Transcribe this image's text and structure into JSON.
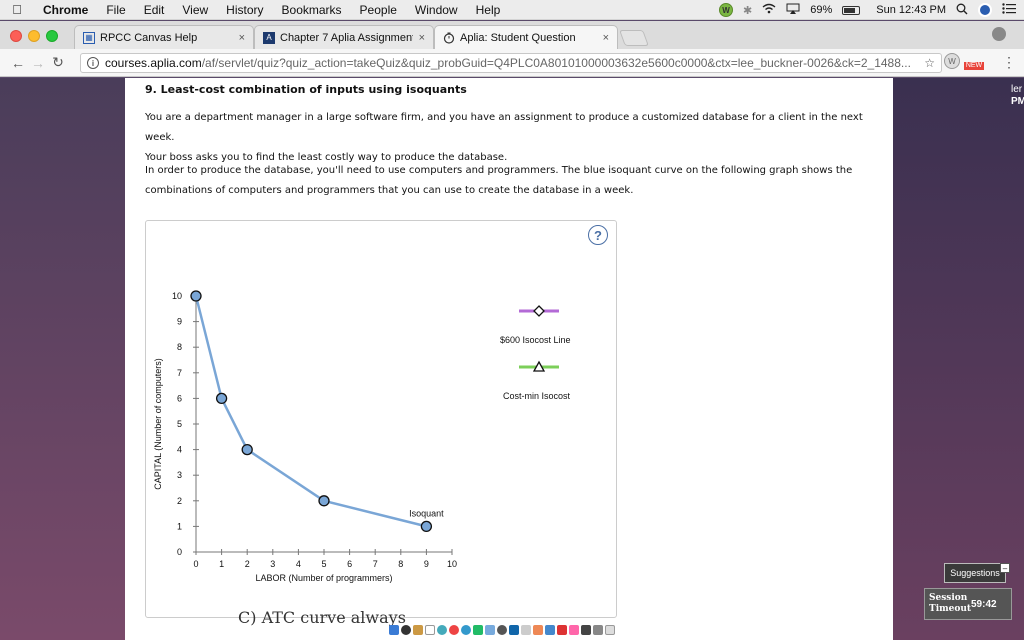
{
  "menubar": {
    "app": "Chrome",
    "items": [
      "File",
      "Edit",
      "View",
      "History",
      "Bookmarks",
      "People",
      "Window",
      "Help"
    ],
    "battery": "69%",
    "clock": "Sun 12:43 PM",
    "ext_letter": "W"
  },
  "tabs": [
    {
      "label": "RPCC Canvas Help",
      "close": "×"
    },
    {
      "label": "Chapter 7 Aplia Assignment",
      "close": "×"
    },
    {
      "label": "Aplia: Student Question",
      "close": "×"
    }
  ],
  "toolbar": {
    "url_host": "courses.aplia.com",
    "url_path": "/af/servlet/quiz?quiz_action=takeQuiz&quiz_probGuid=Q4PLC0A80101000003632e5600c0000&ctx=lee_buckner-0026&ck=2_1488...",
    "ext_new": "NEW",
    "ext_w": "W"
  },
  "question": {
    "title": "9. Least-cost combination of inputs using isoquants",
    "para1_line1": "You are a department manager in a large software firm, and you have an assignment to produce a customized database for a client in the next week.",
    "para1_line2": "Your boss asks you to find the least costly way to produce the database.",
    "para2_line1": "In order to produce the database, you'll need to use computers and programmers. The blue isoquant curve on the following graph shows the",
    "para2_line2": "combinations of computers and programmers that you can use to create the database in a week."
  },
  "graph": {
    "help": "?",
    "legend": [
      {
        "label": "$600 Isocost Line",
        "color": "#b36ad6",
        "marker": "diamond"
      },
      {
        "label": "Cost-min Isocost",
        "color": "#7ccf5a",
        "marker": "triangle"
      }
    ]
  },
  "chart_data": {
    "type": "line",
    "xlabel": "LABOR (Number of programmers)",
    "ylabel": "CAPITAL (Number of computers)",
    "xlim": [
      0,
      10
    ],
    "ylim": [
      0,
      10
    ],
    "x_ticks": [
      0,
      1,
      2,
      3,
      4,
      5,
      6,
      7,
      8,
      9,
      10
    ],
    "y_ticks": [
      0,
      1,
      2,
      3,
      4,
      5,
      6,
      7,
      8,
      9,
      10
    ],
    "series": [
      {
        "name": "Isoquant",
        "color": "#7aa6d6",
        "points": [
          [
            0,
            10
          ],
          [
            1,
            6
          ],
          [
            2,
            4
          ],
          [
            5,
            2
          ],
          [
            9,
            1
          ]
        ]
      }
    ]
  },
  "bottom": {
    "underlying_text": "C) ATC curve always",
    "suggestions": "Suggestions",
    "session_label_1": "Session",
    "session_label_2": "Timeout",
    "session_time": "59:42"
  },
  "edge": {
    "right_top_1": "ler",
    "right_top_2": "PM"
  }
}
